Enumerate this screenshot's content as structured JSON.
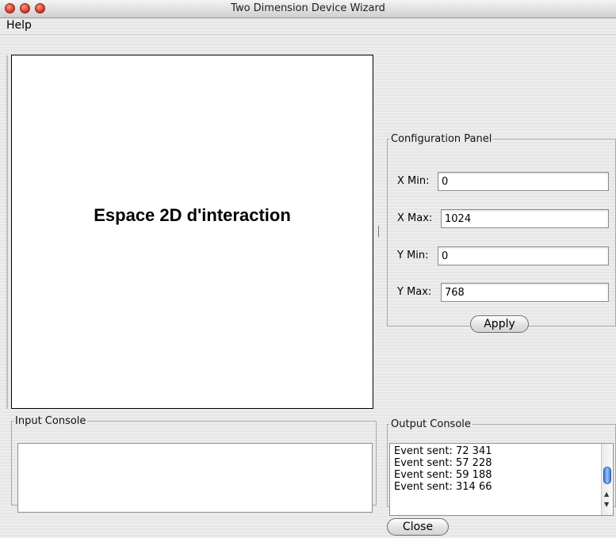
{
  "window": {
    "title": "Two Dimension Device Wizard"
  },
  "menu": {
    "help": "Help"
  },
  "canvas": {
    "label": "Espace 2D d'interaction"
  },
  "config": {
    "legend": "Configuration Panel",
    "x_min_label": "X Min:",
    "x_min_value": "0",
    "x_max_label": "X Max:",
    "x_max_value": "1024",
    "y_min_label": "Y Min:",
    "y_min_value": "0",
    "y_max_label": "Y Max:",
    "y_max_value": "768",
    "apply_label": "Apply"
  },
  "input_console": {
    "legend": "Input Console"
  },
  "output_console": {
    "legend": "Output Console",
    "lines": [
      "Event sent: 72 341",
      "Event sent: 57 228",
      "Event sent: 59 188",
      "Event sent: 314 66"
    ]
  },
  "close_label": "Close"
}
